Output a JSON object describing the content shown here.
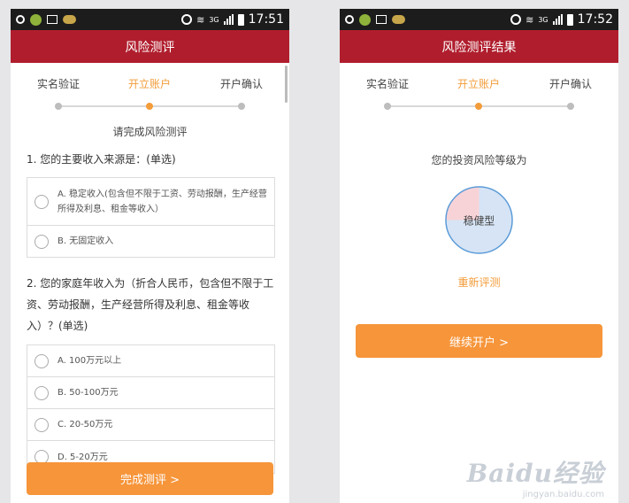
{
  "left": {
    "status": {
      "time": "17:51",
      "network": "3G"
    },
    "title": "风险测评",
    "steps": [
      {
        "label": "实名验证",
        "active": false
      },
      {
        "label": "开立账户",
        "active": true
      },
      {
        "label": "开户确认",
        "active": false
      }
    ],
    "hint": "请完成风险测评",
    "questions": [
      {
        "title": "1. 您的主要收入来源是：(单选)",
        "options": [
          "A. 稳定收入(包含但不限于工资、劳动报酬，生产经营所得及利息、租金等收入）",
          "B. 无固定收入"
        ]
      },
      {
        "title": "2. 您的家庭年收入为（折合人民币，包含但不限于工资、劳动报酬，生产经营所得及利息、租金等收入）？(单选)",
        "options": [
          "A. 100万元以上",
          "B. 50-100万元",
          "C. 20-50万元",
          "D. 5-20万元"
        ]
      }
    ],
    "submit_label": "完成测评 >"
  },
  "right": {
    "status": {
      "time": "17:52",
      "network": "3G"
    },
    "title": "风险测评结果",
    "steps": [
      {
        "label": "实名验证",
        "active": false
      },
      {
        "label": "开立账户",
        "active": true
      },
      {
        "label": "开户确认",
        "active": false
      }
    ],
    "result_label": "您的投资风险等级为",
    "risk_level": "稳健型",
    "risk_share": 0.25,
    "reevaluate_label": "重新评测",
    "continue_label": "继续开户 >"
  },
  "watermark": {
    "logo": "Baidu经验",
    "url": "jingyan.baidu.com"
  },
  "colors": {
    "title_bar": "#b01e2d",
    "accent": "#f6953a",
    "pie_fill": "#d6e4f5",
    "pie_slice": "#f7d3d8",
    "pie_border": "#5a9bd8"
  }
}
